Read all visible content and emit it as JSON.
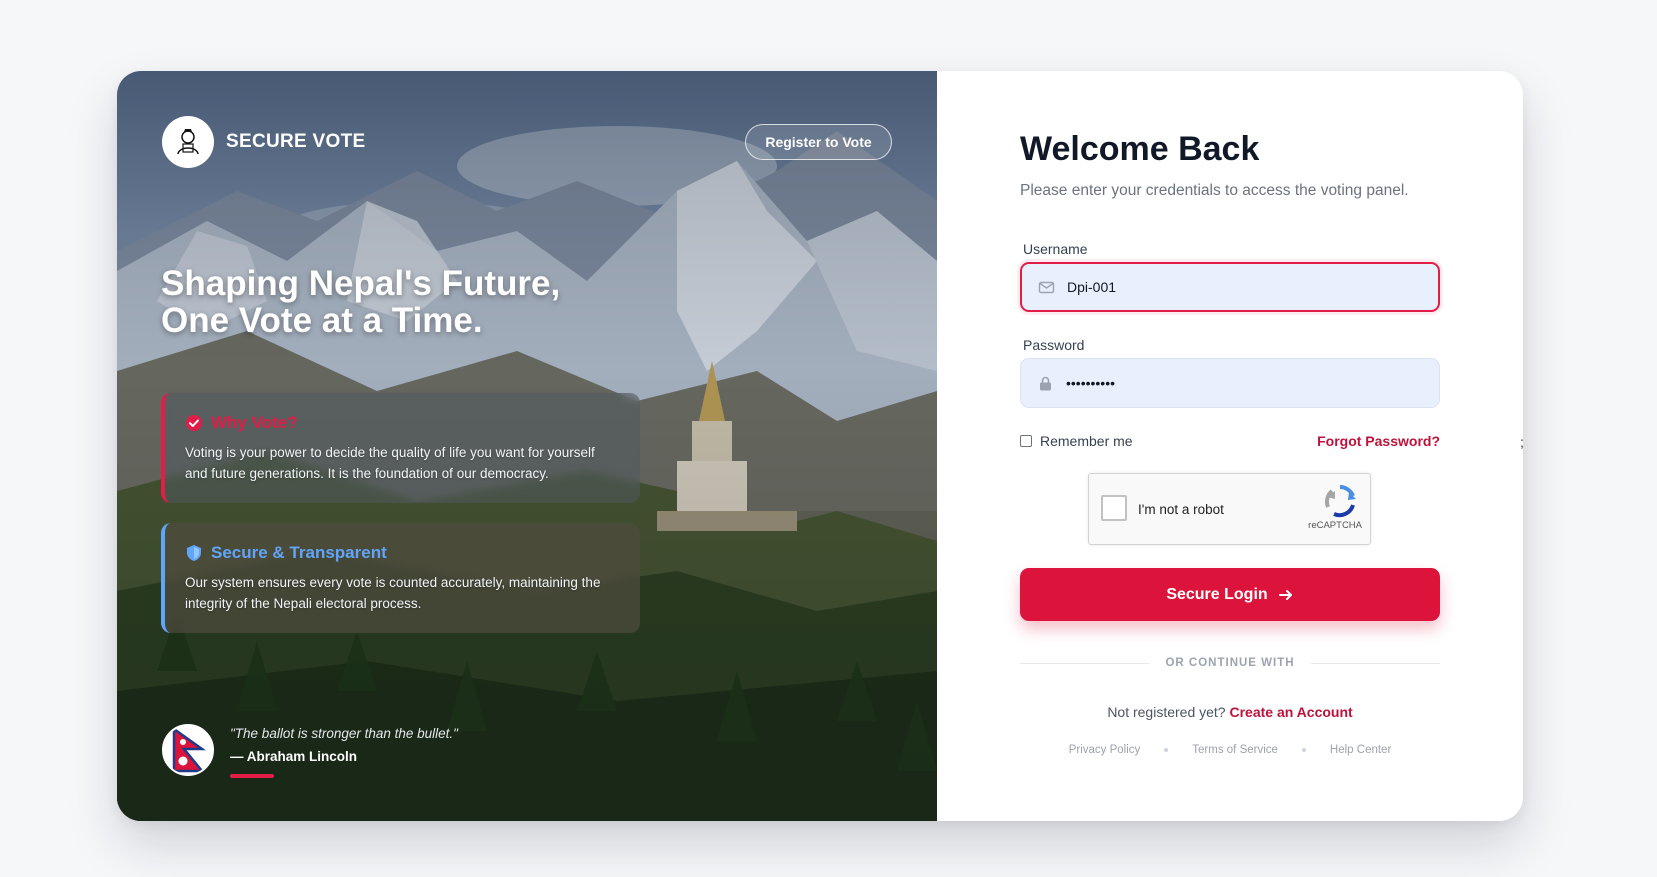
{
  "brand": {
    "name": "SECURE VOTE",
    "logo_icon": "voter-avatar-icon"
  },
  "header": {
    "register_label": "Register to Vote"
  },
  "hero": {
    "headline_line1": "Shaping Nepal's Future,",
    "headline_line2": "One Vote at a Time."
  },
  "cards": [
    {
      "title": "Why Vote?",
      "icon": "check-circle-icon",
      "color": "#e11d48",
      "text": "Voting is your power to decide the quality of life you want for yourself and future generations. It is the foundation of our democracy."
    },
    {
      "title": "Secure & Transparent",
      "icon": "shield-icon",
      "color": "#60a5fa",
      "text": "Our system ensures every vote is counted accurately, maintaining the integrity of the Nepali electoral process."
    }
  ],
  "quote": {
    "text": "\"The ballot is stronger than the bullet.\"",
    "author": "— Abraham Lincoln",
    "icon": "nepal-flag-icon"
  },
  "login": {
    "title": "Welcome Back",
    "subtitle": "Please enter your credentials to access the voting panel.",
    "username_label": "Username",
    "username_value": "Dpi-001",
    "password_label": "Password",
    "password_value": "••••••••••",
    "remember_label": "Remember me",
    "forgot_label": "Forgot Password?",
    "captcha_label": "I'm not a robot",
    "captcha_brand": "reCAPTCHA",
    "submit_label": "Secure Login",
    "divider_label": "OR CONTINUE WITH",
    "signup_prompt": "Not registered yet?",
    "signup_link": "Create an Account"
  },
  "footer": {
    "links": [
      "Privacy Policy",
      "Terms of Service",
      "Help Center"
    ]
  },
  "colors": {
    "accent": "#dc143c",
    "blue": "#60a5fa",
    "input_bg": "#e8f0fe"
  },
  "stray_char": ";"
}
